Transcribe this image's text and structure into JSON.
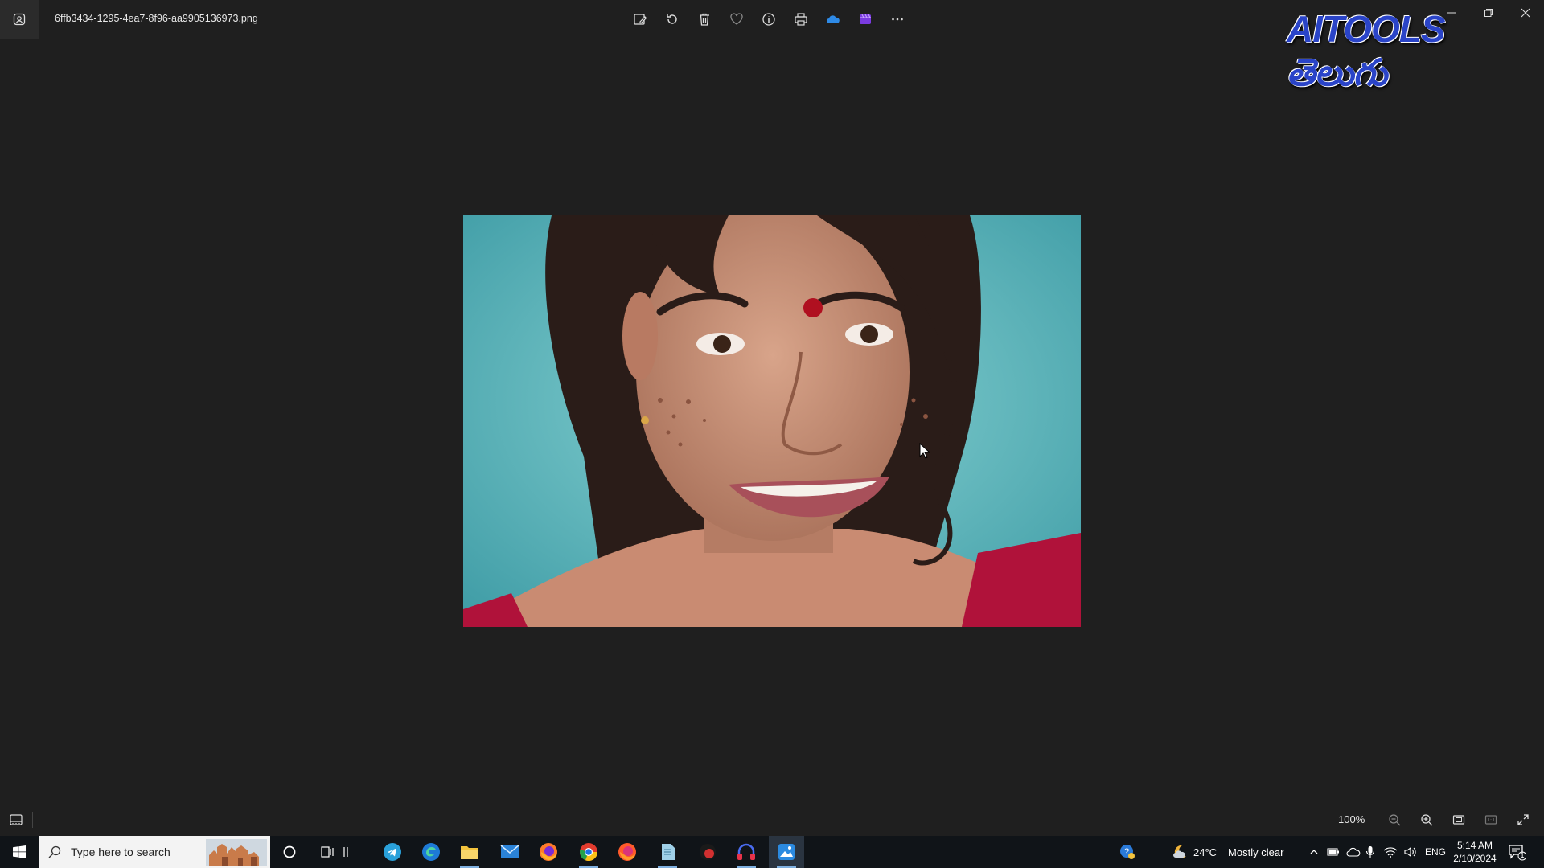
{
  "window": {
    "filename": "6ffb3434-1295-4ea7-8f96-aa9905136973.png",
    "toolbar_icons": [
      "edit-image-icon",
      "rotate-icon",
      "delete-icon",
      "favorite-icon",
      "info-icon",
      "print-icon",
      "onedrive-icon",
      "clipchamp-icon",
      "more-icon"
    ],
    "controls": [
      "minimize-icon",
      "restore-icon",
      "close-icon"
    ]
  },
  "watermark": {
    "text": "AITOOLS తెలుగు"
  },
  "bottom_bar": {
    "zoom_level": "100%",
    "icons": [
      "filmstrip-icon",
      "zoom-out-icon",
      "zoom-in-icon",
      "fit-icon",
      "actual-size-icon",
      "fullscreen-icon"
    ]
  },
  "taskbar": {
    "search_placeholder": "Type here to search",
    "apps": [
      "cortana",
      "task-view",
      "telegram",
      "edge",
      "file-explorer",
      "mail",
      "firefox",
      "chrome",
      "firefox-dev",
      "notepad",
      "app-red",
      "headphones",
      "photos"
    ],
    "weather": {
      "temp": "24°C",
      "condition": "Mostly clear"
    },
    "language": "ENG",
    "time": "5:14 AM",
    "date": "2/10/2024",
    "notification_count": "1"
  },
  "colors": {
    "background": "#1f1f1f",
    "taskbar": "#101418",
    "accent": "#7fb0e0"
  }
}
